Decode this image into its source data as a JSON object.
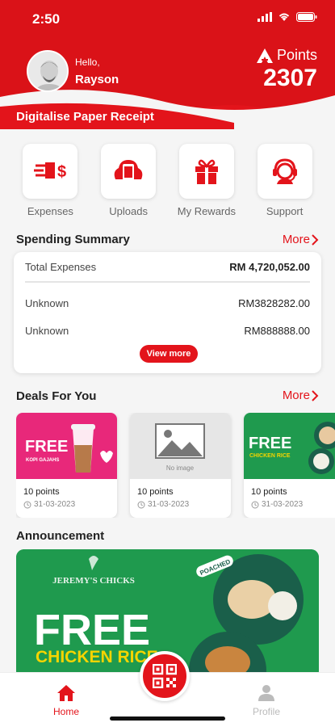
{
  "status_bar": {
    "time": "2:50"
  },
  "header": {
    "greeting": "Hello,",
    "user_name": "Rayson",
    "points_label": "Points",
    "points_value": "2307",
    "banner_text": "Digitalise Paper Receipt"
  },
  "quick_actions": [
    {
      "label": "Expenses",
      "icon": "expenses-icon"
    },
    {
      "label": "Uploads",
      "icon": "uploads-icon"
    },
    {
      "label": "My Rewards",
      "icon": "gift-icon"
    },
    {
      "label": "Support",
      "icon": "support-icon"
    }
  ],
  "spending_summary": {
    "title": "Spending Summary",
    "more_label": "More",
    "total_label": "Total Expenses",
    "total_value": "RM 4,720,052.00",
    "rows": [
      {
        "label": "Unknown",
        "value": "RM3828282.00"
      },
      {
        "label": "Unknown",
        "value": "RM888888.00"
      }
    ],
    "view_more_label": "View more"
  },
  "deals": {
    "title": "Deals For You",
    "more_label": "More",
    "items": [
      {
        "image_text": "FREE",
        "image_subtext": "KOPI GAJAHS",
        "points": "10 points",
        "date": "31-03-2023"
      },
      {
        "image_text": "No image",
        "points": "10 points",
        "date": "31-03-2023"
      },
      {
        "image_text": "FREE",
        "image_subtext": "CHICKEN RICE",
        "points": "10 points",
        "date": "31-03-2023"
      }
    ]
  },
  "announcement": {
    "title": "Announcement",
    "brand": "JEREMY'S CHICKS",
    "headline": "FREE",
    "subheadline": "CHICKEN RICE",
    "tag": "POACHED"
  },
  "tabbar": {
    "home_label": "Home",
    "profile_label": "Profile"
  },
  "colors": {
    "brand_red": "#e3141b",
    "green": "#1f9a4e"
  }
}
